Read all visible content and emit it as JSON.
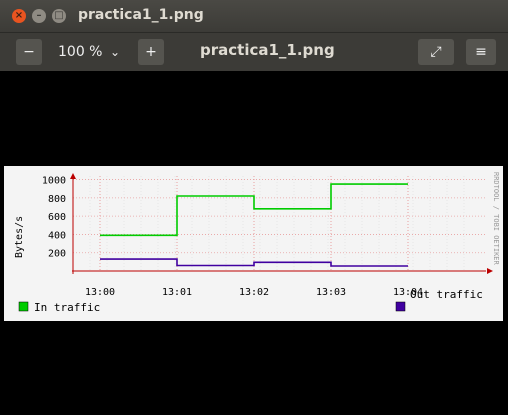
{
  "window": {
    "title": "practica1_1.png",
    "close_glyph": "×",
    "min_glyph": "–",
    "max_glyph": "□"
  },
  "toolbar": {
    "zoom_out_glyph": "−",
    "zoom_value": "100 %",
    "zoom_dropdown_glyph": "⌄",
    "zoom_in_glyph": "+",
    "doc_title": "practica1_1.png",
    "fullscreen_glyph": "⤢",
    "menu_glyph": "≡"
  },
  "icons": {
    "close": "close-icon",
    "minimize": "minimize-icon",
    "maximize": "maximize-icon",
    "zoom_out": "minus-icon",
    "zoom_in": "plus-icon",
    "dropdown": "chevron-down-icon",
    "fullscreen": "fullscreen-icon",
    "menu": "hamburger-menu-icon"
  },
  "colors": {
    "in_traffic": "#00cc00",
    "out_traffic": "#4000a0",
    "close_button": "#e95420"
  },
  "chart_data": {
    "type": "line",
    "title": "",
    "ylabel": "Bytes/s",
    "xlabel": "",
    "ylim": [
      0,
      1050
    ],
    "grid": true,
    "x_ticks": [
      "13:00",
      "13:01",
      "13:02",
      "13:03",
      "13:04"
    ],
    "y_ticks": [
      "200",
      "400",
      "600",
      "800",
      "1000"
    ],
    "watermark": "RRDTOOL / TOBI OETIKER",
    "legend_placement": "bottom",
    "series": [
      {
        "name": "In traffic",
        "color": "#00cc00",
        "x": [
          "13:00",
          "13:01",
          "13:01",
          "13:02",
          "13:02",
          "13:03",
          "13:03",
          "13:04"
        ],
        "values": [
          390,
          390,
          820,
          820,
          680,
          680,
          950,
          950
        ]
      },
      {
        "name": "Out traffic",
        "color": "#4000a0",
        "x": [
          "13:00",
          "13:01",
          "13:01",
          "13:02",
          "13:02",
          "13:03",
          "13:03",
          "13:04"
        ],
        "values": [
          130,
          130,
          60,
          60,
          95,
          95,
          55,
          55
        ]
      }
    ]
  }
}
